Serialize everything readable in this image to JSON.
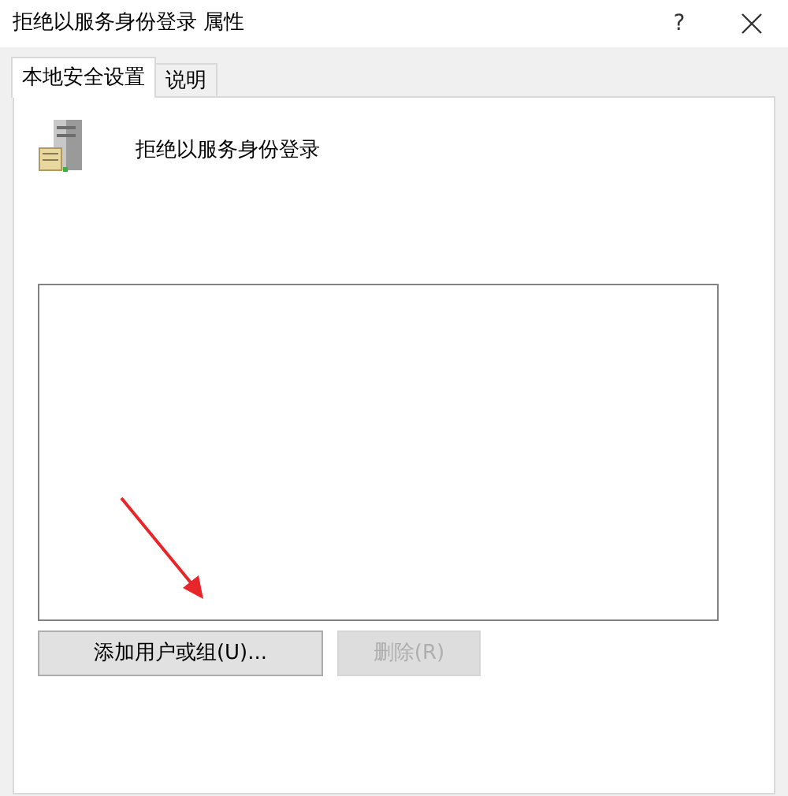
{
  "window": {
    "title": "拒绝以服务身份登录 属性",
    "help": "?"
  },
  "tabs": [
    {
      "label": "本地安全设置",
      "selected": true
    },
    {
      "label": "说明",
      "selected": false
    }
  ],
  "policy": {
    "name": "拒绝以服务身份登录"
  },
  "buttons": [
    {
      "label": "添加用户或组(U)...",
      "disabled": false
    },
    {
      "label": "删除(R)",
      "disabled": true
    }
  ]
}
